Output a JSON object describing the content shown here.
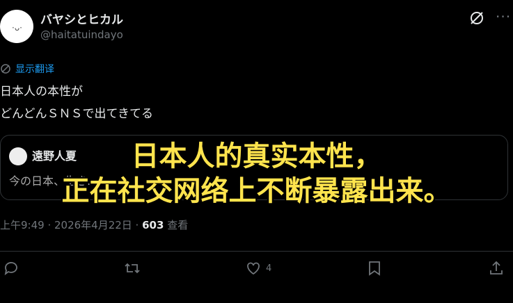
{
  "author": {
    "name": "バヤシとヒカル",
    "handle": "@haitatuindayo"
  },
  "translate_label": "显示翻译",
  "post": {
    "line1": "日本人の本性が",
    "line2": "どんどんＳＮＳで出てきてる"
  },
  "quote": {
    "name": "遠野人夏",
    "text": "今の日本、生き…"
  },
  "overlay": {
    "line1": "日本人的真实本性，",
    "line2": "正在社交网络上不断暴露出来。"
  },
  "meta": {
    "time": "上午9:49 · 2026年4月22日 · ",
    "views_count": "603",
    "views_label": " 查看"
  },
  "actions": {
    "like_count": "4"
  },
  "colors": {
    "background": "#000000",
    "accent": "#1d9bf0",
    "muted": "#71767b",
    "overlay_text": "#ffe44d"
  }
}
